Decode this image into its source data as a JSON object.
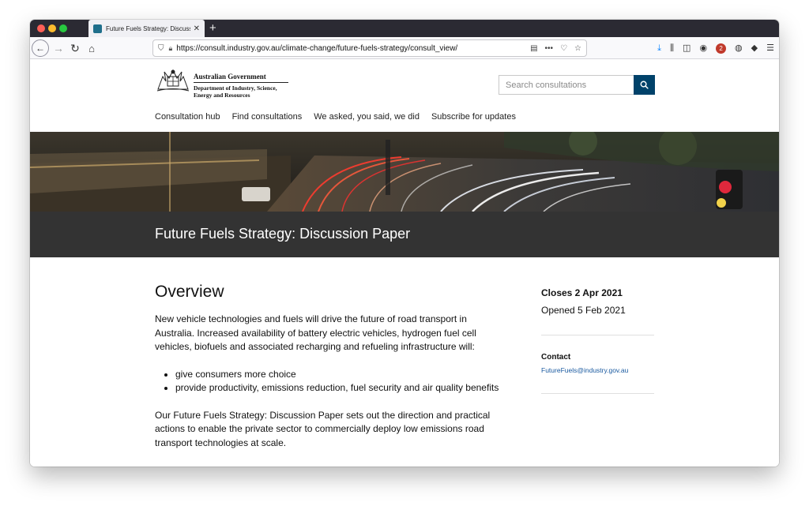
{
  "browser": {
    "tab_title": "Future Fuels Strategy: Discussi",
    "tab_close": "✕",
    "new_tab": "+",
    "url": "https://consult.industry.gov.au/climate-change/future-fuels-strategy/consult_view/",
    "icons": [
      "back-icon",
      "forward-icon",
      "reload-icon",
      "home-icon",
      "shield-icon",
      "lock-icon",
      "reader-icon",
      "more-icon",
      "pocket-icon",
      "star-icon",
      "download-icon",
      "library-icon",
      "sidebar-icon",
      "account-icon",
      "ublock-icon",
      "extension-icon",
      "layers-icon",
      "menu-icon"
    ],
    "ublock_count": "2"
  },
  "header": {
    "gov_line1": "Australian Government",
    "gov_line2": "Department of Industry, Science,",
    "gov_line3": "Energy and Resources",
    "search_placeholder": "Search consultations"
  },
  "nav": {
    "items": [
      {
        "label": "Consultation hub"
      },
      {
        "label": "Find consultations"
      },
      {
        "label": "We asked, you said, we did"
      },
      {
        "label": "Subscribe for updates"
      }
    ]
  },
  "page": {
    "title": "Future Fuels Strategy: Discussion Paper"
  },
  "overview": {
    "heading": "Overview",
    "para1": "New vehicle technologies and fuels will drive the future of road transport in Australia. Increased availability of battery electric vehicles, hydrogen fuel cell vehicles, biofuels and associated recharging and refueling infrastructure will:",
    "bullets": [
      "give consumers more choice",
      "provide productivity, emissions reduction, fuel security and air quality benefits"
    ],
    "para2": "Our Future Fuels Strategy: Discussion Paper sets out the direction and practical actions to enable the private sector to commercially deploy low emissions road transport technologies at scale."
  },
  "sidebar": {
    "closes": "Closes 2 Apr 2021",
    "opened": "Opened 5 Feb 2021",
    "contact_label": "Contact",
    "contact_email": "FutureFuels@industry.gov.au"
  },
  "colors": {
    "tab_strip": "#2b2a33",
    "search_button": "#00426a",
    "title_band": "#333333",
    "link": "#1a5aa0"
  }
}
